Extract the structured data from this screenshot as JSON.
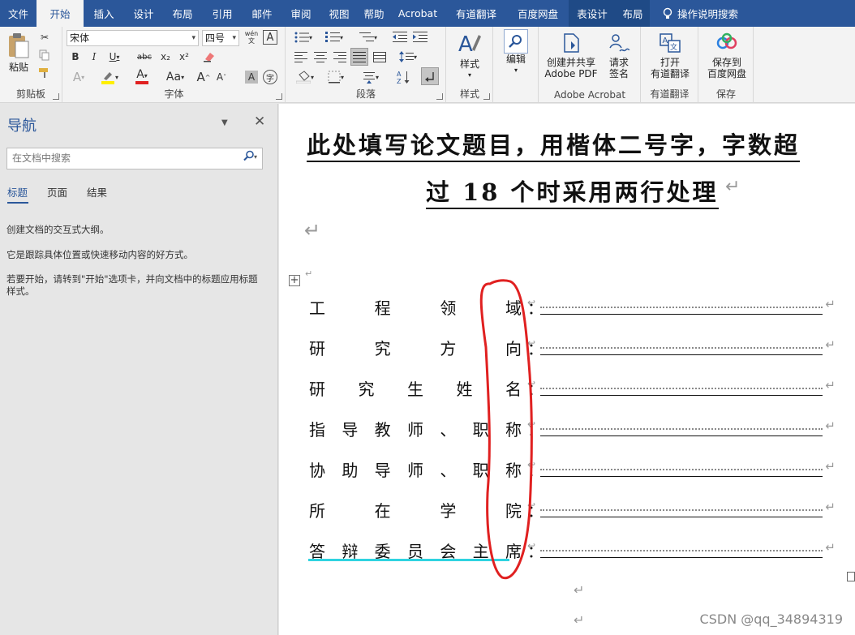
{
  "tabs": [
    "文件",
    "开始",
    "插入",
    "设计",
    "布局",
    "引用",
    "邮件",
    "审阅",
    "视图",
    "帮助",
    "Acrobat",
    "有道翻译",
    "百度网盘",
    "表设计",
    "布局"
  ],
  "tell_me": "操作说明搜索",
  "ribbon": {
    "clipboard": {
      "paste": "粘贴",
      "label": "剪贴板"
    },
    "font": {
      "family": "宋体",
      "size": "四号",
      "label": "字体",
      "wen": "wén 文",
      "A_box": "A",
      "bold": "B",
      "italic": "I",
      "underline": "U",
      "strike": "abc",
      "sub": "x₂",
      "sup": "x²",
      "aa": "Aa",
      "grow": "A",
      "shrink": "A",
      "char_border": "A",
      "enclosed": "字"
    },
    "paragraph": {
      "label": "段落"
    },
    "styles": {
      "btn": "样式",
      "label": "样式"
    },
    "editing": {
      "btn": "编辑"
    },
    "acrobat": {
      "create": "创建并共享",
      "create2": "Adobe PDF",
      "request": "请求",
      "request2": "签名",
      "label": "Adobe Acrobat"
    },
    "youdao": {
      "open": "打开",
      "open2": "有道翻译",
      "label": "有道翻译"
    },
    "baidu": {
      "save": "保存到",
      "save2": "百度网盘",
      "label": "保存"
    }
  },
  "nav": {
    "title": "导航",
    "search_placeholder": "在文档中搜索",
    "tabs": [
      "标题",
      "页面",
      "结果"
    ],
    "text1": "创建文档的交互式大纲。",
    "text2": "它是跟踪具体位置或快速移动内容的好方式。",
    "text3": "若要开始，请转到\"开始\"选项卡，并向文档中的标题应用标题样式。"
  },
  "doc": {
    "title1": "此处填写论文题目，用楷体二号字，字数超",
    "title2": "过 18 个时采用两行处理",
    "rows": [
      {
        "chars": [
          "工",
          "程",
          "领",
          "域"
        ],
        "colon": "："
      },
      {
        "chars": [
          "研",
          "究",
          "方",
          "向"
        ],
        "colon": "："
      },
      {
        "chars": [
          "研",
          "究",
          "生",
          "姓",
          "名"
        ],
        "colon": "："
      },
      {
        "chars": [
          "指",
          "导",
          "教",
          "师",
          "、",
          "职",
          "称"
        ],
        "colon": "："
      },
      {
        "chars": [
          "协",
          "助",
          "导",
          "师",
          "、",
          "职",
          "称"
        ],
        "colon": "："
      },
      {
        "chars": [
          "所",
          "在",
          "学",
          "院"
        ],
        "colon": "："
      },
      {
        "chars": [
          "答",
          "辩",
          "委",
          "员",
          "会",
          "主",
          "席"
        ],
        "colon": "："
      }
    ]
  },
  "watermark": "CSDN @qq_34894319",
  "colors": {
    "accent": "#2b579a",
    "annotation_red": "#e02020",
    "cyan_underline": "#2fd3e0"
  }
}
